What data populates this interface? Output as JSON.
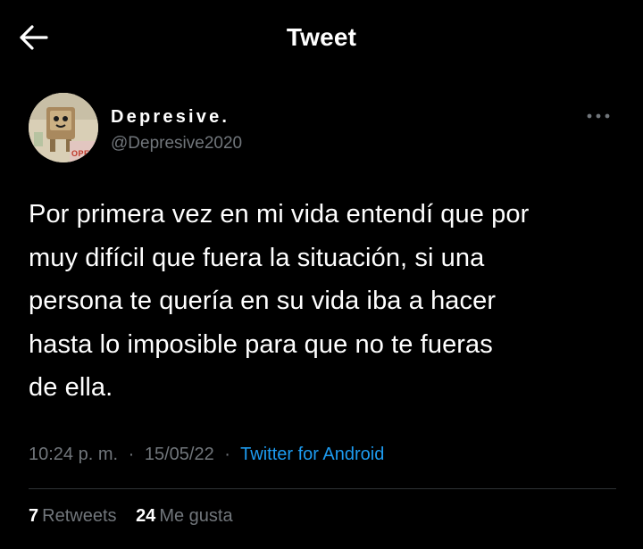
{
  "header": {
    "title": "Tweet",
    "back_icon": "arrow-left-icon"
  },
  "author": {
    "display_name": "Depresive.",
    "handle": "@Depresive2020",
    "avatar_badge_text": "OPE",
    "more_icon": "more-horizontal-icon"
  },
  "tweet": {
    "text": "Por primera vez en mi vida entendí que por\nmuy difícil que fuera la situación, si una\npersona te quería en su vida iba a hacer\nhasta lo imposible para que no te fueras\nde ella.",
    "time": "10:24 p. m.",
    "separator": "·",
    "date": "15/05/22",
    "source": "Twitter for Android"
  },
  "stats": {
    "retweets_count": "7",
    "retweets_label": "Retweets",
    "likes_count": "24",
    "likes_label": "Me gusta"
  },
  "colors": {
    "background": "#000000",
    "primary_text": "#ffffff",
    "secondary_text": "#71767b",
    "link": "#1d9bf0",
    "divider": "#2f3336"
  }
}
